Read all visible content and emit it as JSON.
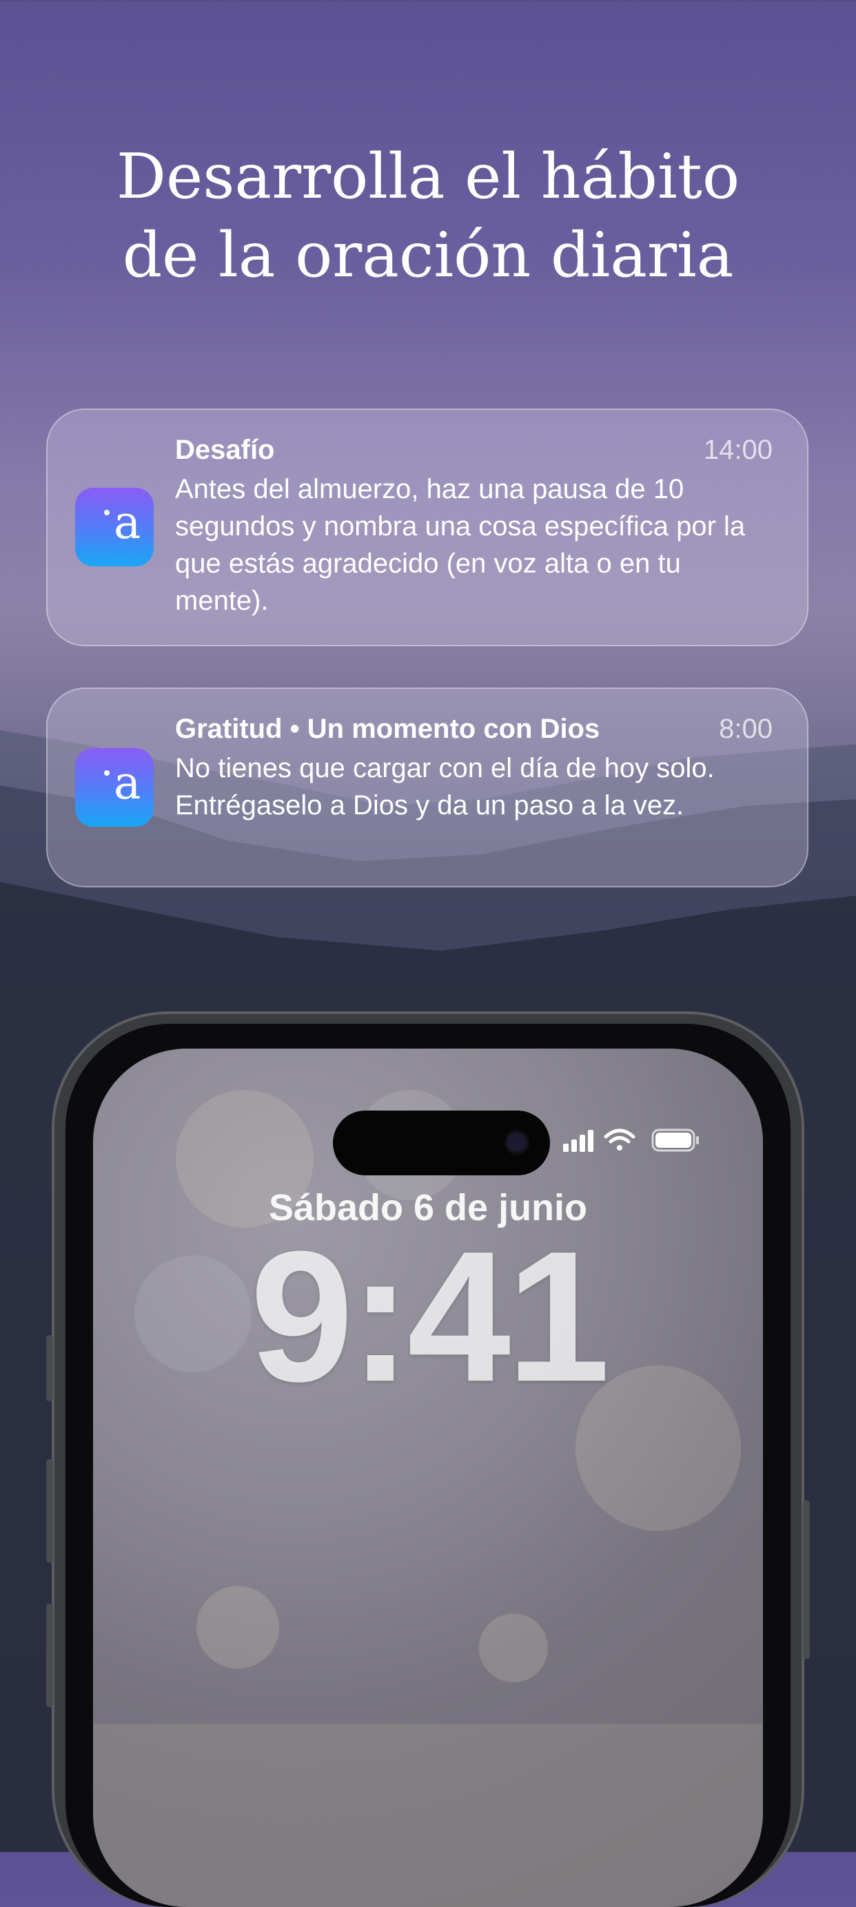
{
  "headline": {
    "line1": "Desarrolla el hábito",
    "line2": "de la oración diaria"
  },
  "notifications": [
    {
      "icon": "app-icon-a",
      "title": "Desafío",
      "time": "14:00",
      "body": "Antes del almuerzo, haz una pausa de 10 segundos y nombra una cosa específica por la que estás agradecido (en voz alta o en tu mente)."
    },
    {
      "icon": "app-icon-a",
      "title": "Gratitud • Un momento con Dios",
      "time": "8:00",
      "body": "No tienes que cargar con el día de hoy solo. Entrégaselo a Dios y da un paso a la vez."
    }
  ],
  "app_icon_glyph": "a",
  "lock_screen": {
    "date": "Sábado 6 de junio",
    "time": "9:41"
  },
  "colors": {
    "background_top": "#5b5193",
    "background_bottom": "#0d0d12",
    "icon_gradient_top": "#8a5cf6",
    "icon_gradient_bottom": "#19a6f5"
  }
}
